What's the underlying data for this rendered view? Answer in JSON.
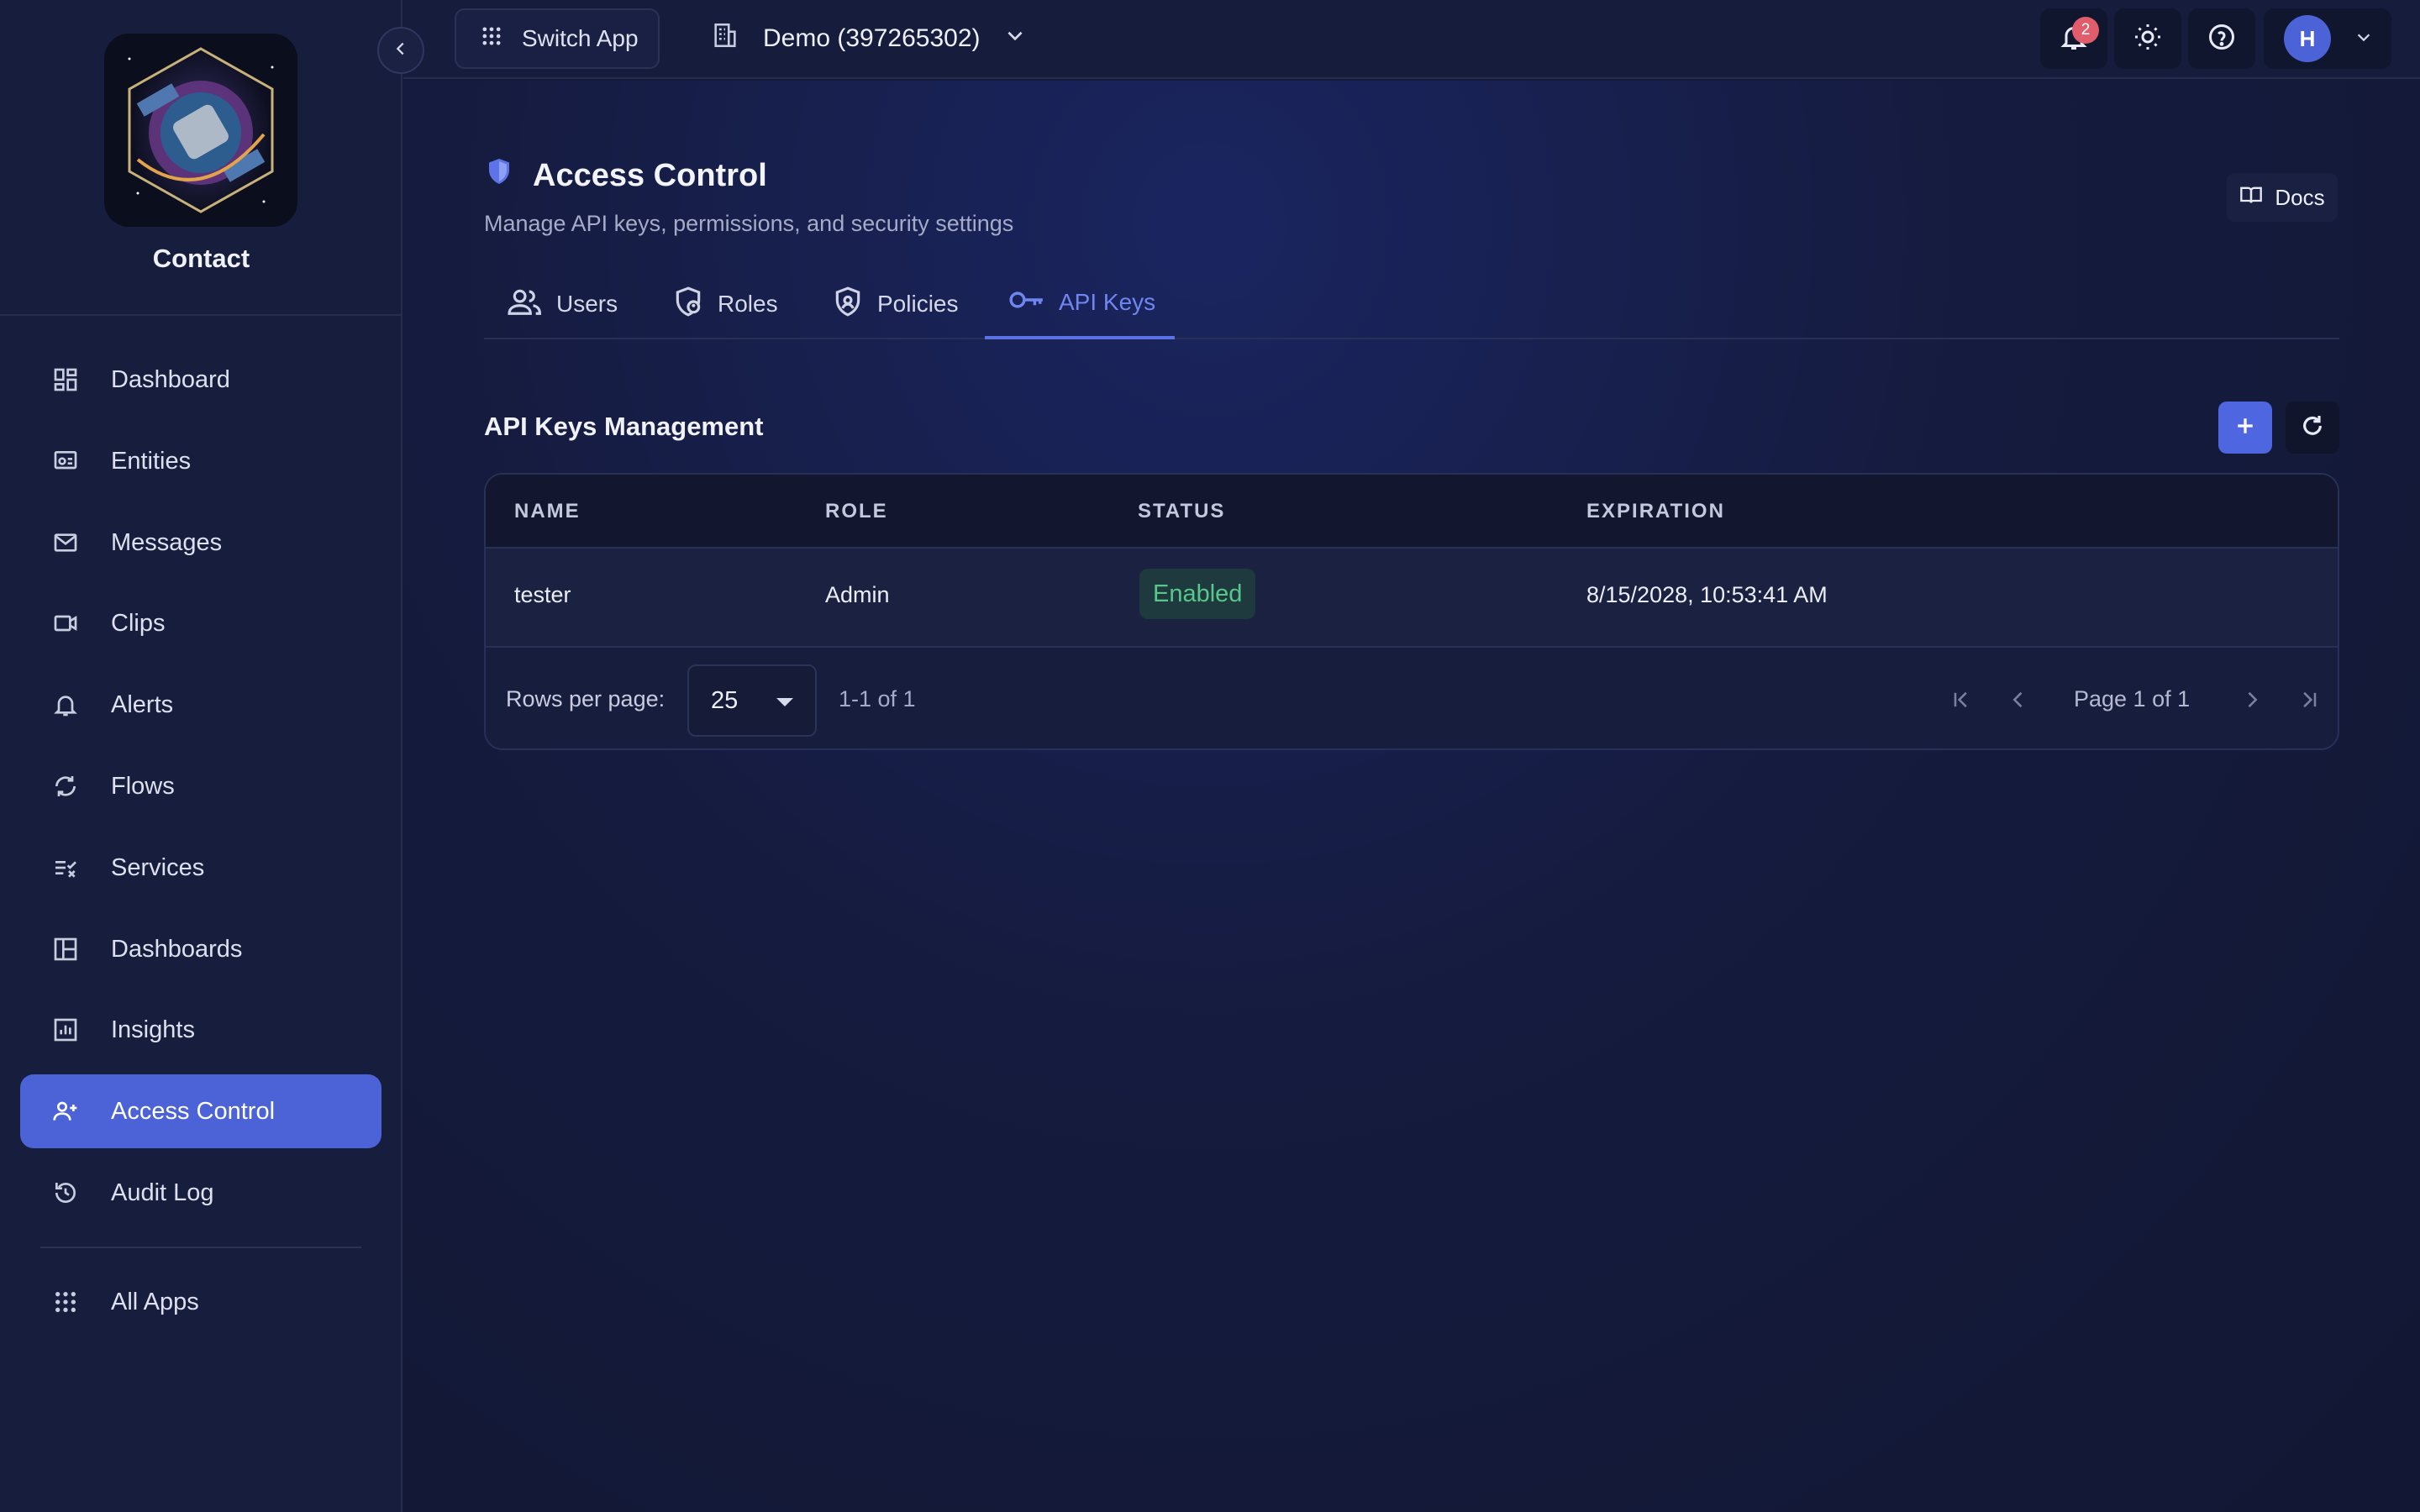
{
  "app": {
    "name": "Contact"
  },
  "sidebar": {
    "items": [
      {
        "label": "Dashboard",
        "icon": "dashboard-icon"
      },
      {
        "label": "Entities",
        "icon": "entities-icon"
      },
      {
        "label": "Messages",
        "icon": "mail-icon"
      },
      {
        "label": "Clips",
        "icon": "video-icon"
      },
      {
        "label": "Alerts",
        "icon": "bell-icon"
      },
      {
        "label": "Flows",
        "icon": "flows-icon"
      },
      {
        "label": "Services",
        "icon": "services-icon"
      },
      {
        "label": "Dashboards",
        "icon": "dashboards-icon"
      },
      {
        "label": "Insights",
        "icon": "insights-icon"
      },
      {
        "label": "Access Control",
        "icon": "access-control-icon",
        "active": true
      },
      {
        "label": "Audit Log",
        "icon": "history-icon"
      }
    ],
    "footer": {
      "label": "All Apps",
      "icon": "grid-icon"
    }
  },
  "topbar": {
    "switch_app": "Switch App",
    "org": "Demo (397265302)",
    "notifications_count": "2",
    "avatar_initial": "H"
  },
  "page": {
    "title": "Access Control",
    "subtitle": "Manage API keys, permissions, and security settings",
    "docs": "Docs",
    "tabs": [
      {
        "label": "Users"
      },
      {
        "label": "Roles"
      },
      {
        "label": "Policies"
      },
      {
        "label": "API Keys",
        "active": true
      }
    ]
  },
  "api_keys": {
    "section_title": "API Keys Management",
    "columns": [
      "NAME",
      "ROLE",
      "STATUS",
      "EXPIRATION"
    ],
    "rows": [
      {
        "name": "tester",
        "role": "Admin",
        "status": "Enabled",
        "expiration": "8/15/2028, 10:53:41 AM"
      }
    ],
    "pagination": {
      "rows_per_page_label": "Rows per page:",
      "rows_per_page": "25",
      "range": "1-1 of 1",
      "page_info": "Page 1 of 1"
    }
  },
  "colors": {
    "accent": "#4c63d8",
    "status_enabled": "#58c88a",
    "badge": "#e15d6b"
  }
}
